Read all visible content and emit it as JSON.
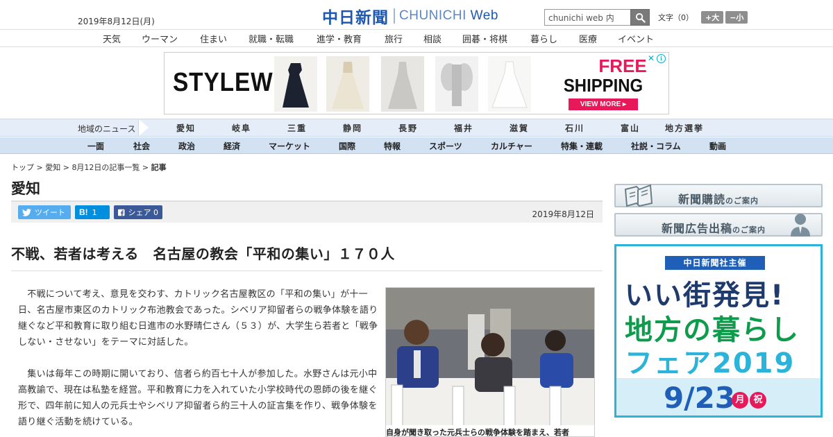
{
  "header": {
    "date": "2019年8月12日(月)",
    "logo_jp": "中日新聞",
    "logo_en_a": "CHUNICHI ",
    "logo_en_b": "Web",
    "search_value": "chunichi web 内",
    "font_label": "文字（0）",
    "font_bigger": "+大",
    "font_smaller": "−小"
  },
  "topnav": [
    "天気",
    "ウーマン",
    "住まい",
    "就職・転職",
    "進学・教育",
    "旅行",
    "相談",
    "囲碁・将棋",
    "暮らし",
    "医療",
    "イベント"
  ],
  "ad": {
    "brand": "STYLEWE",
    "free": "FREE",
    "shipping": "SHIPPING",
    "view_more": "VIEW MORE ▸",
    "info": "i",
    "close": "✕"
  },
  "region": {
    "label": "地域のニュース",
    "items": [
      "愛知",
      "岐阜",
      "三重",
      "静岡",
      "長野",
      "福井",
      "滋賀",
      "石川",
      "富山",
      "地方選挙"
    ]
  },
  "mainnav": [
    "一面",
    "社会",
    "政治",
    "経済",
    "マーケット",
    "国際",
    "特報",
    "スポーツ",
    "カルチャー",
    "特集・連載",
    "社説・コラム",
    "動画"
  ],
  "breadcrumb": {
    "top": "トップ",
    "sep": " > ",
    "region": "愛知",
    "list": "8月12日の記事一覧",
    "current": "記事"
  },
  "article": {
    "section": "愛知",
    "tweet": "ツイート",
    "hatena_count": "1",
    "share_label": "シェア",
    "share_count": "0",
    "date": "2019年8月12日",
    "headline": "不戦、若者は考える　名古屋の教会「平和の集い」１７０人",
    "p1": "　不戦について考え、意見を交わす、カトリック名古屋教区の「平和の集い」が十一日、名古屋市東区のカトリック布池教会であった。シベリア抑留者らの戦争体験を語り継ぐなど平和教育に取り組む日進市の水野晴仁さん（５３）が、大学生ら若者と「戦争しない・させない」をテーマに対話した。",
    "p2": "　集いは毎年この時期に開いており、信者ら約百七十人が参加した。水野さんは元小中高教諭で、現在は私塾を経営。平和教育に力を入れていた小学校時代の恩師の後を継ぐ形で、四年前に知人の元兵士やシベリア抑留者ら約三十人の証言集を作り、戦争体験を語り継ぐ活動を続けている。",
    "photo_caption": "自身が聞き取った元兵士らの戦争体験を踏まえ、若者"
  },
  "sidebar": {
    "btn1_main": "新聞購読",
    "btn1_small": "のご案内",
    "btn2_main": "新聞広告出稿",
    "btn2_small": "のご案内",
    "fair_banner": "中日新聞社主催",
    "fair_line1": "いい街発見!",
    "fair_line2": "地方の暮らし",
    "fair_line3": "フェア2019",
    "fair_date": "9/23",
    "fair_dow1": "月",
    "fair_dow2": "祝"
  },
  "colors": {
    "brand_blue": "#1a58b4",
    "region_bg": "#e5eef8",
    "mainnav_bg": "#d3e2f3",
    "twitter": "#55acee",
    "hatena": "#008fde",
    "facebook": "#3b5998",
    "ad_pink": "#e8195a",
    "fair_border": "#2bb3d9"
  }
}
